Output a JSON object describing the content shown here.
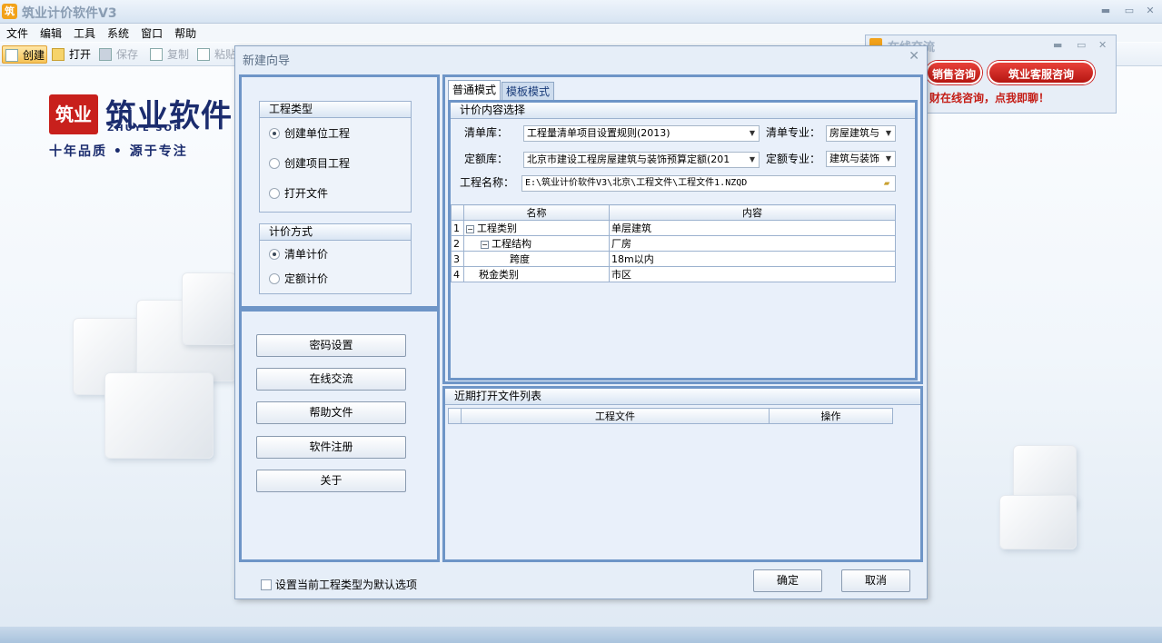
{
  "app": {
    "title": "筑业计价软件V3",
    "icon": "筑"
  },
  "window_controls": {
    "minimize": "▬",
    "restore": "▭",
    "close": "✕"
  },
  "menu": [
    "文件",
    "编辑",
    "工具",
    "系统",
    "窗口",
    "帮助"
  ],
  "toolbar": {
    "create": "创建",
    "open": "打开",
    "save": "保存",
    "copy": "复制",
    "paste": "粘贴"
  },
  "brand": {
    "logo_char": "筑业",
    "name": "筑业软件",
    "english": "ZHUYE SOF",
    "slogan": "十年品质 • 源于专注"
  },
  "chat_window": {
    "title": "在线交流",
    "sales_button": "销售咨询",
    "support_button": "筑业客服咨询",
    "banner": "财在线咨询，点我即聊！"
  },
  "dialog": {
    "title": "新建向导",
    "close": "✕",
    "project_type": {
      "header": "工程类型",
      "options": [
        "创建单位工程",
        "创建项目工程",
        "打开文件"
      ],
      "selected": 0
    },
    "pricing_method": {
      "header": "计价方式",
      "options": [
        "清单计价",
        "定额计价"
      ],
      "selected": 0
    },
    "side_buttons": [
      "密码设置",
      "在线交流",
      "帮助文件",
      "软件注册",
      "关于"
    ],
    "tabs": [
      "普通模式",
      "模板模式"
    ],
    "active_tab": 0,
    "pricing_content": {
      "header": "计价内容选择",
      "list_lib_label": "清单库：",
      "list_lib_value": "工程量清单项目设置规则(2013)",
      "list_spec_label": "清单专业：",
      "list_spec_value": "房屋建筑与",
      "quota_lib_label": "定额库：",
      "quota_lib_value": "北京市建设工程房屋建筑与装饰预算定额(201",
      "quota_spec_label": "定额专业：",
      "quota_spec_value": "建筑与装饰",
      "project_name_label": "工程名称：",
      "project_name_value": "E:\\筑业计价软件V3\\北京\\工程文件\\工程文件1.NZQD"
    },
    "attr_table": {
      "headers": [
        "名称",
        "内容"
      ],
      "rows": [
        {
          "num": "1",
          "name": "工程类别",
          "value": "单层建筑"
        },
        {
          "num": "2",
          "name": "工程结构",
          "value": "厂房"
        },
        {
          "num": "3",
          "name": "跨度",
          "value": "18m以内"
        },
        {
          "num": "4",
          "name": "税金类别",
          "value": "市区"
        }
      ]
    },
    "recent_files": {
      "header": "近期打开文件列表",
      "headers": [
        "工程文件",
        "操作"
      ]
    },
    "default_checkbox": "设置当前工程类型为默认选项",
    "ok": "确定",
    "cancel": "取消"
  }
}
